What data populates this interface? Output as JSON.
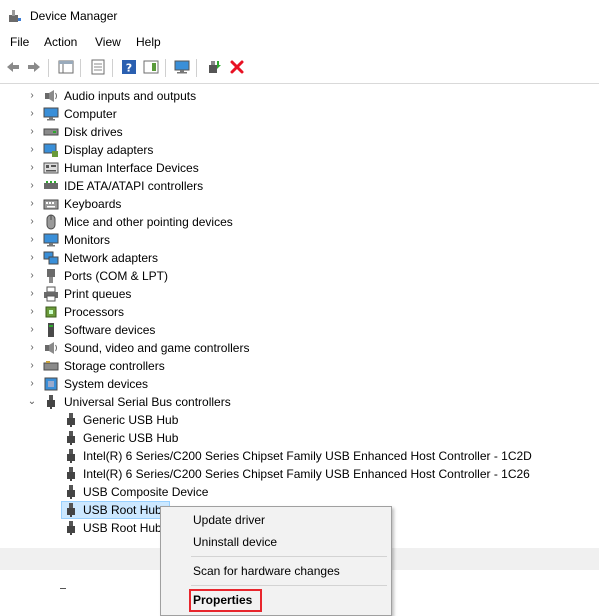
{
  "window": {
    "title": "Device Manager"
  },
  "menu": [
    "File",
    "Action",
    "View",
    "Help"
  ],
  "tree": {
    "categories": [
      {
        "label": "Audio inputs and outputs",
        "icon": "speaker-icon"
      },
      {
        "label": "Computer",
        "icon": "monitor-icon"
      },
      {
        "label": "Disk drives",
        "icon": "disk-drive-icon"
      },
      {
        "label": "Display adapters",
        "icon": "display-adapter-icon"
      },
      {
        "label": "Human Interface Devices",
        "icon": "hid-icon"
      },
      {
        "label": "IDE ATA/ATAPI controllers",
        "icon": "ide-controller-icon"
      },
      {
        "label": "Keyboards",
        "icon": "keyboard-icon"
      },
      {
        "label": "Mice and other pointing devices",
        "icon": "mouse-icon"
      },
      {
        "label": "Monitors",
        "icon": "monitor-icon"
      },
      {
        "label": "Network adapters",
        "icon": "network-adapter-icon"
      },
      {
        "label": "Ports (COM & LPT)",
        "icon": "port-icon"
      },
      {
        "label": "Print queues",
        "icon": "printer-icon"
      },
      {
        "label": "Processors",
        "icon": "processor-icon"
      },
      {
        "label": "Software devices",
        "icon": "software-device-icon"
      },
      {
        "label": "Sound, video and game controllers",
        "icon": "speaker-icon"
      },
      {
        "label": "Storage controllers",
        "icon": "storage-controller-icon"
      },
      {
        "label": "System devices",
        "icon": "system-device-icon"
      },
      {
        "label": "Universal Serial Bus controllers",
        "icon": "usb-icon"
      }
    ],
    "usb_children": [
      "Generic USB Hub",
      "Generic USB Hub",
      "Intel(R) 6 Series/C200 Series Chipset Family USB Enhanced Host Controller - 1C2D",
      "Intel(R) 6 Series/C200 Series Chipset Family USB Enhanced Host Controller - 1C26",
      "USB Composite Device",
      "USB Root Hub",
      "USB Root Hub"
    ]
  },
  "context_menu": {
    "update_driver": "Update driver",
    "uninstall_device": "Uninstall device",
    "scan_hardware": "Scan for hardware changes",
    "properties": "Properties"
  },
  "colors": {
    "selection_bg": "#cce8ff",
    "highlight_border": "#e8262d",
    "uninstall_red": "#e81123",
    "help_blue": "#2a5fb0"
  }
}
